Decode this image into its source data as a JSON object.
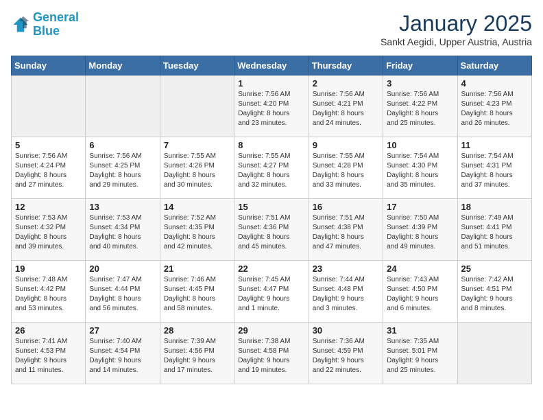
{
  "header": {
    "logo_line1": "General",
    "logo_line2": "Blue",
    "title": "January 2025",
    "subtitle": "Sankt Aegidi, Upper Austria, Austria"
  },
  "days_of_week": [
    "Sunday",
    "Monday",
    "Tuesday",
    "Wednesday",
    "Thursday",
    "Friday",
    "Saturday"
  ],
  "weeks": [
    [
      {
        "day": "",
        "detail": ""
      },
      {
        "day": "",
        "detail": ""
      },
      {
        "day": "",
        "detail": ""
      },
      {
        "day": "1",
        "detail": "Sunrise: 7:56 AM\nSunset: 4:20 PM\nDaylight: 8 hours\nand 23 minutes."
      },
      {
        "day": "2",
        "detail": "Sunrise: 7:56 AM\nSunset: 4:21 PM\nDaylight: 8 hours\nand 24 minutes."
      },
      {
        "day": "3",
        "detail": "Sunrise: 7:56 AM\nSunset: 4:22 PM\nDaylight: 8 hours\nand 25 minutes."
      },
      {
        "day": "4",
        "detail": "Sunrise: 7:56 AM\nSunset: 4:23 PM\nDaylight: 8 hours\nand 26 minutes."
      }
    ],
    [
      {
        "day": "5",
        "detail": "Sunrise: 7:56 AM\nSunset: 4:24 PM\nDaylight: 8 hours\nand 27 minutes."
      },
      {
        "day": "6",
        "detail": "Sunrise: 7:56 AM\nSunset: 4:25 PM\nDaylight: 8 hours\nand 29 minutes."
      },
      {
        "day": "7",
        "detail": "Sunrise: 7:55 AM\nSunset: 4:26 PM\nDaylight: 8 hours\nand 30 minutes."
      },
      {
        "day": "8",
        "detail": "Sunrise: 7:55 AM\nSunset: 4:27 PM\nDaylight: 8 hours\nand 32 minutes."
      },
      {
        "day": "9",
        "detail": "Sunrise: 7:55 AM\nSunset: 4:28 PM\nDaylight: 8 hours\nand 33 minutes."
      },
      {
        "day": "10",
        "detail": "Sunrise: 7:54 AM\nSunset: 4:30 PM\nDaylight: 8 hours\nand 35 minutes."
      },
      {
        "day": "11",
        "detail": "Sunrise: 7:54 AM\nSunset: 4:31 PM\nDaylight: 8 hours\nand 37 minutes."
      }
    ],
    [
      {
        "day": "12",
        "detail": "Sunrise: 7:53 AM\nSunset: 4:32 PM\nDaylight: 8 hours\nand 39 minutes."
      },
      {
        "day": "13",
        "detail": "Sunrise: 7:53 AM\nSunset: 4:34 PM\nDaylight: 8 hours\nand 40 minutes."
      },
      {
        "day": "14",
        "detail": "Sunrise: 7:52 AM\nSunset: 4:35 PM\nDaylight: 8 hours\nand 42 minutes."
      },
      {
        "day": "15",
        "detail": "Sunrise: 7:51 AM\nSunset: 4:36 PM\nDaylight: 8 hours\nand 45 minutes."
      },
      {
        "day": "16",
        "detail": "Sunrise: 7:51 AM\nSunset: 4:38 PM\nDaylight: 8 hours\nand 47 minutes."
      },
      {
        "day": "17",
        "detail": "Sunrise: 7:50 AM\nSunset: 4:39 PM\nDaylight: 8 hours\nand 49 minutes."
      },
      {
        "day": "18",
        "detail": "Sunrise: 7:49 AM\nSunset: 4:41 PM\nDaylight: 8 hours\nand 51 minutes."
      }
    ],
    [
      {
        "day": "19",
        "detail": "Sunrise: 7:48 AM\nSunset: 4:42 PM\nDaylight: 8 hours\nand 53 minutes."
      },
      {
        "day": "20",
        "detail": "Sunrise: 7:47 AM\nSunset: 4:44 PM\nDaylight: 8 hours\nand 56 minutes."
      },
      {
        "day": "21",
        "detail": "Sunrise: 7:46 AM\nSunset: 4:45 PM\nDaylight: 8 hours\nand 58 minutes."
      },
      {
        "day": "22",
        "detail": "Sunrise: 7:45 AM\nSunset: 4:47 PM\nDaylight: 9 hours\nand 1 minute."
      },
      {
        "day": "23",
        "detail": "Sunrise: 7:44 AM\nSunset: 4:48 PM\nDaylight: 9 hours\nand 3 minutes."
      },
      {
        "day": "24",
        "detail": "Sunrise: 7:43 AM\nSunset: 4:50 PM\nDaylight: 9 hours\nand 6 minutes."
      },
      {
        "day": "25",
        "detail": "Sunrise: 7:42 AM\nSunset: 4:51 PM\nDaylight: 9 hours\nand 8 minutes."
      }
    ],
    [
      {
        "day": "26",
        "detail": "Sunrise: 7:41 AM\nSunset: 4:53 PM\nDaylight: 9 hours\nand 11 minutes."
      },
      {
        "day": "27",
        "detail": "Sunrise: 7:40 AM\nSunset: 4:54 PM\nDaylight: 9 hours\nand 14 minutes."
      },
      {
        "day": "28",
        "detail": "Sunrise: 7:39 AM\nSunset: 4:56 PM\nDaylight: 9 hours\nand 17 minutes."
      },
      {
        "day": "29",
        "detail": "Sunrise: 7:38 AM\nSunset: 4:58 PM\nDaylight: 9 hours\nand 19 minutes."
      },
      {
        "day": "30",
        "detail": "Sunrise: 7:36 AM\nSunset: 4:59 PM\nDaylight: 9 hours\nand 22 minutes."
      },
      {
        "day": "31",
        "detail": "Sunrise: 7:35 AM\nSunset: 5:01 PM\nDaylight: 9 hours\nand 25 minutes."
      },
      {
        "day": "",
        "detail": ""
      }
    ]
  ]
}
